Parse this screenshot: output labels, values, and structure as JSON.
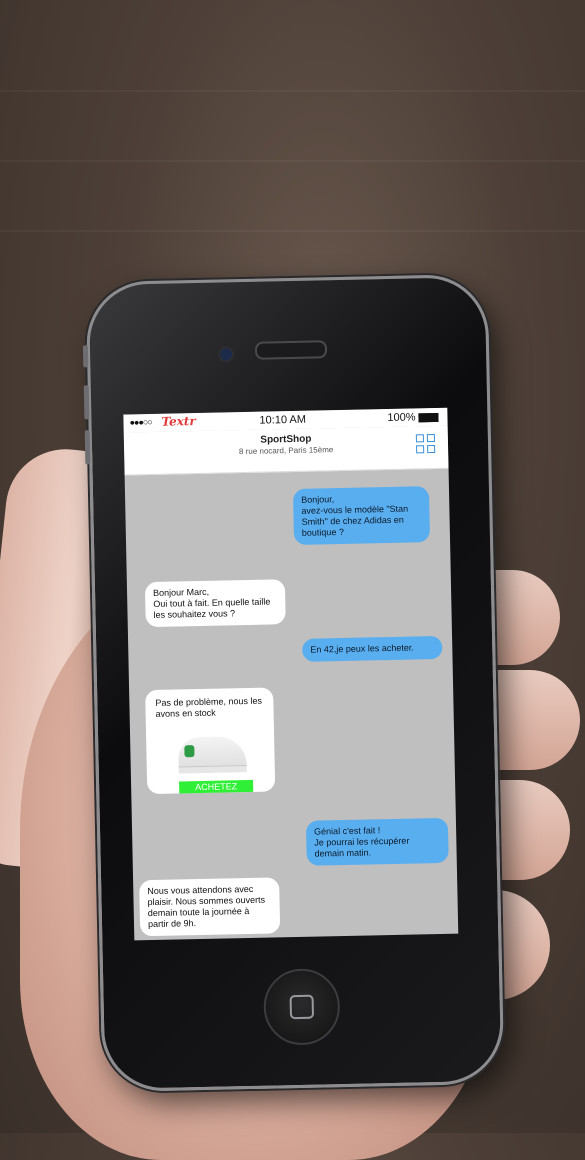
{
  "status_bar": {
    "signal": "●●●○○",
    "carrier": "Textr",
    "time": "10:10 AM",
    "battery": "100%"
  },
  "header": {
    "shop_name": "SportShop",
    "address": "8 rue nocard, Paris 15ème"
  },
  "messages": [
    {
      "from": "user",
      "text": "Bonjour,\navez-vous le modèle \"Stan Smith\" de chez Adidas en boutique ?"
    },
    {
      "from": "shop",
      "text": "Bonjour Marc,\nOui tout à fait. En quelle taille les souhaitez vous ?"
    },
    {
      "from": "user",
      "text": "En 42,je peux les acheter."
    },
    {
      "from": "shop",
      "text": "Pas de problème, nous les avons en stock",
      "button": "ACHETEZ"
    },
    {
      "from": "user",
      "text": "Génial c'est fait !\nJe pourrai les récupérer demain matin."
    },
    {
      "from": "shop",
      "text": "Nous vous attendons avec plaisir. Nous sommes ouverts demain toute la journée à partir de 9h."
    }
  ],
  "colors": {
    "outgoing_bubble": "#59aef0",
    "incoming_bubble": "#ffffff",
    "buy_button": "#2ff036",
    "carrier_red": "#e23b3b"
  }
}
